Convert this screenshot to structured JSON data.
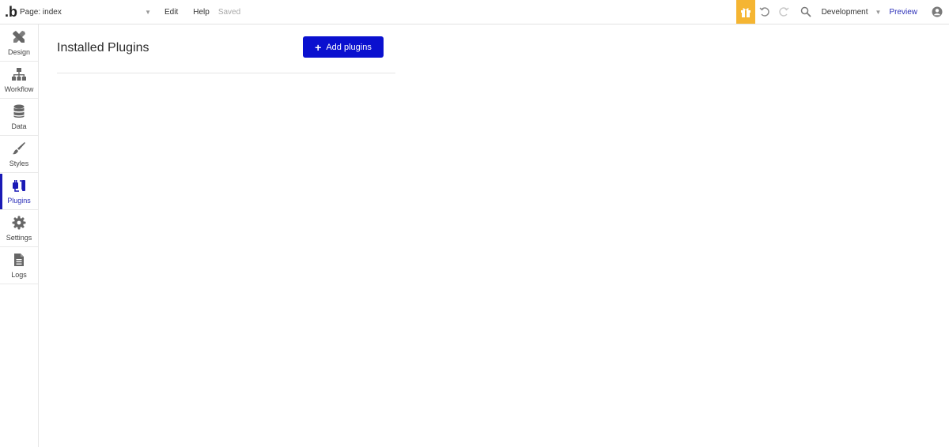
{
  "topbar": {
    "logo_text": ".b",
    "page_selector": "Page: index",
    "menu": {
      "edit": "Edit",
      "help": "Help"
    },
    "status": "Saved",
    "environment": "Development",
    "preview": "Preview",
    "colors": {
      "gift": "#f5b532",
      "preview_link": "#2b2fb8"
    },
    "icons": [
      "gift-icon",
      "undo-icon",
      "redo-icon",
      "search-icon",
      "account-icon"
    ]
  },
  "sidebar": {
    "active": "Plugins",
    "items": [
      {
        "label": "Design",
        "icon": "design-icon"
      },
      {
        "label": "Workflow",
        "icon": "workflow-icon"
      },
      {
        "label": "Data",
        "icon": "database-icon"
      },
      {
        "label": "Styles",
        "icon": "brush-icon"
      },
      {
        "label": "Plugins",
        "icon": "plugin-icon"
      },
      {
        "label": "Settings",
        "icon": "gear-icon"
      },
      {
        "label": "Logs",
        "icon": "document-icon"
      }
    ]
  },
  "main": {
    "title": "Installed Plugins",
    "add_button": "Add plugins",
    "accent_color": "#0a10cf"
  }
}
